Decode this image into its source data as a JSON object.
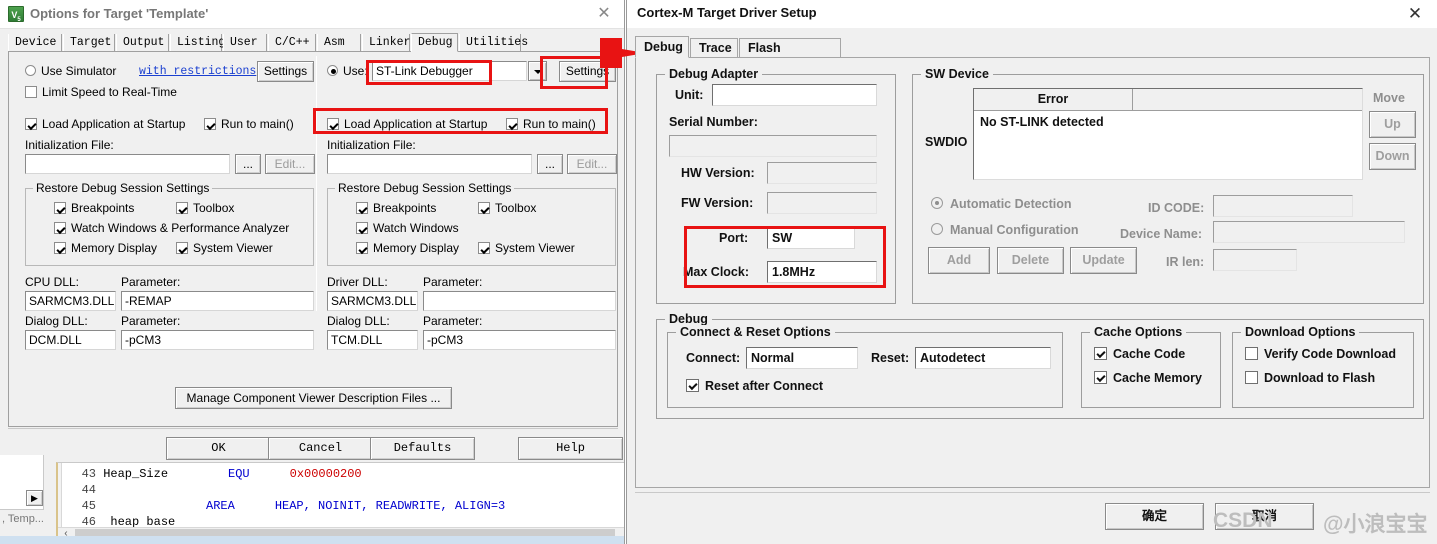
{
  "left_dialog": {
    "title": "Options for Target 'Template'",
    "app_icon": "keil-uvision-icon",
    "close_label": "✕",
    "tabs": [
      {
        "label": "Device",
        "selected": false
      },
      {
        "label": "Target",
        "selected": false
      },
      {
        "label": "Output",
        "selected": false
      },
      {
        "label": "Listing",
        "selected": false
      },
      {
        "label": "User",
        "selected": false
      },
      {
        "label": "C/C++",
        "selected": false
      },
      {
        "label": "Asm",
        "selected": false
      },
      {
        "label": "Linker",
        "selected": false
      },
      {
        "label": "Debug",
        "selected": true
      },
      {
        "label": "Utilities",
        "selected": false
      }
    ],
    "simulator": {
      "radio_label": "Use Simulator",
      "radio_checked": false,
      "restrictions_link": "with restrictions",
      "settings_button": "Settings",
      "limit_speed_label": "Limit Speed to Real-Time",
      "limit_speed_checked": false,
      "load_app_label": "Load Application at Startup",
      "load_app_checked": true,
      "run_main_label": "Run to main()",
      "run_main_checked": true,
      "init_file_label": "Initialization File:",
      "init_file_value": "",
      "browse_button": "...",
      "edit_button": "Edit..."
    },
    "debugger": {
      "radio_label": "Use:",
      "radio_checked": true,
      "selected_debugger": "ST-Link Debugger",
      "settings_button": "Settings",
      "load_app_label": "Load Application at Startup",
      "load_app_checked": true,
      "run_main_label": "Run to main()",
      "run_main_checked": true,
      "init_file_label": "Initialization File:",
      "init_file_value": "",
      "browse_button": "...",
      "edit_button": "Edit..."
    },
    "restore_left": {
      "caption": "Restore Debug Session Settings",
      "items": [
        {
          "label": "Breakpoints",
          "checked": true
        },
        {
          "label": "Toolbox",
          "checked": true
        },
        {
          "label": "Watch Windows & Performance Analyzer",
          "checked": true
        },
        {
          "label": "Memory Display",
          "checked": true
        },
        {
          "label": "System Viewer",
          "checked": true
        }
      ]
    },
    "restore_right": {
      "caption": "Restore Debug Session Settings",
      "items": [
        {
          "label": "Breakpoints",
          "checked": true
        },
        {
          "label": "Toolbox",
          "checked": true
        },
        {
          "label": "Watch Windows",
          "checked": true
        },
        {
          "label": "Memory Display",
          "checked": true
        },
        {
          "label": "System Viewer",
          "checked": true
        }
      ]
    },
    "dll_left": {
      "cpu_dll_label": "CPU DLL:",
      "cpu_dll_value": "SARMCM3.DLL",
      "cpu_param_label": "Parameter:",
      "cpu_param_value": "-REMAP",
      "dialog_dll_label": "Dialog DLL:",
      "dialog_dll_value": "DCM.DLL",
      "dialog_param_label": "Parameter:",
      "dialog_param_value": "-pCM3"
    },
    "dll_right": {
      "driver_dll_label": "Driver DLL:",
      "driver_dll_value": "SARMCM3.DLL",
      "driver_param_label": "Parameter:",
      "driver_param_value": "",
      "dialog_dll_label": "Dialog DLL:",
      "dialog_dll_value": "TCM.DLL",
      "dialog_param_label": "Parameter:",
      "dialog_param_value": "-pCM3"
    },
    "manage_button": "Manage Component Viewer Description Files ...",
    "buttons": {
      "ok": "OK",
      "cancel": "Cancel",
      "defaults": "Defaults",
      "help": "Help"
    }
  },
  "code_editor": {
    "lines": [
      {
        "num": "43",
        "label": "Heap_Size",
        "kw": "EQU",
        "val": "0x00000200"
      },
      {
        "num": "44",
        "label": "",
        "kw": "",
        "val": ""
      },
      {
        "num": "45",
        "label": "",
        "kw": "AREA",
        "val": "HEAP, NOINIT, READWRITE, ALIGN=3"
      },
      {
        "num": "46",
        "label": "heap base",
        "kw": "",
        "val": ""
      }
    ],
    "scroll_left_arrow": "‹",
    "side_tab": ", Temp...",
    "side_arrow": "▶"
  },
  "right_dialog": {
    "title": "Cortex-M Target Driver Setup",
    "close_label": "✕",
    "tabs": [
      {
        "label": "Debug",
        "selected": true
      },
      {
        "label": "Trace",
        "selected": false
      },
      {
        "label": "Flash Download",
        "selected": false
      }
    ],
    "debug_adapter": {
      "caption": "Debug Adapter",
      "unit_label": "Unit:",
      "unit_value": "",
      "serial_label": "Serial Number:",
      "serial_value": "",
      "hw_label": "HW Version:",
      "hw_value": "",
      "fw_label": "FW Version:",
      "fw_value": "",
      "port_label": "Port:",
      "port_value": "SW",
      "max_clock_label": "Max Clock:",
      "max_clock_value": "1.8MHz"
    },
    "sw_device": {
      "caption": "SW Device",
      "swdio_label": "SWDIO",
      "columns": [
        "Error",
        ""
      ],
      "rows": [
        "No ST-LINK detected"
      ],
      "move_label": "Move",
      "up_button": "Up",
      "down_button": "Down",
      "auto_label": "Automatic Detection",
      "auto_checked": true,
      "manual_label": "Manual Configuration",
      "manual_checked": false,
      "idcode_label": "ID CODE:",
      "idcode_value": "",
      "device_name_label": "Device Name:",
      "device_name_value": "",
      "irlen_label": "IR len:",
      "irlen_value": "",
      "add_button": "Add",
      "delete_button": "Delete",
      "update_button": "Update"
    },
    "debug_group": {
      "caption": "Debug",
      "connect_reset_caption": "Connect & Reset Options",
      "connect_label": "Connect:",
      "connect_value": "Normal",
      "reset_label": "Reset:",
      "reset_value": "Autodetect",
      "reset_after_connect_label": "Reset after Connect",
      "reset_after_connect_checked": true
    },
    "cache_options": {
      "caption": "Cache Options",
      "items": [
        {
          "label": "Cache Code",
          "checked": true
        },
        {
          "label": "Cache Memory",
          "checked": true
        }
      ]
    },
    "download_options": {
      "caption": "Download Options",
      "items": [
        {
          "label": "Verify Code Download",
          "checked": false
        },
        {
          "label": "Download to Flash",
          "checked": false
        }
      ]
    },
    "buttons": {
      "ok": "确定",
      "cancel": "取消"
    }
  },
  "watermark": {
    "site": "CSDN",
    "user": "@小浪宝宝"
  },
  "annotations": {
    "highlight_color": "#e81313",
    "arrow_name": "red-arrow-pointing-to-debug-tab"
  }
}
